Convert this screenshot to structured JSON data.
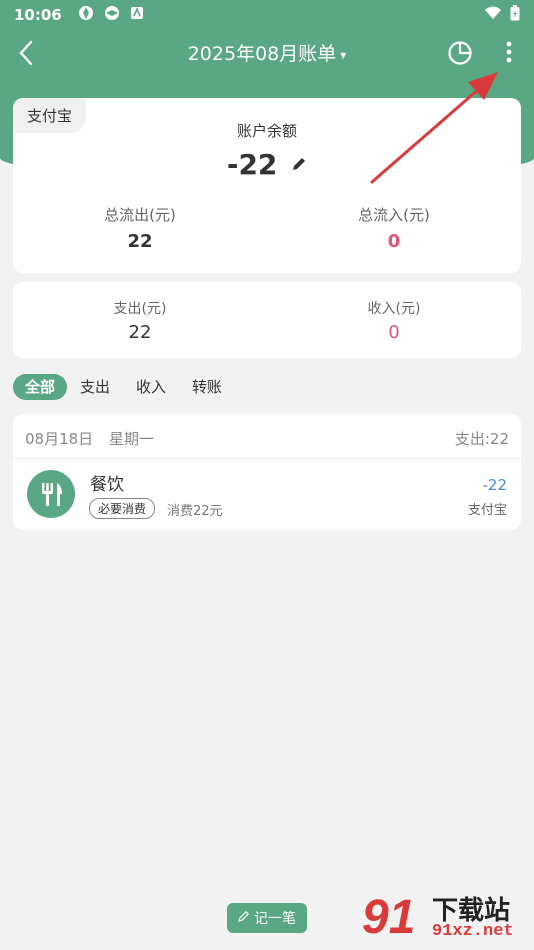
{
  "status_bar": {
    "time": "10:06",
    "icons": [
      "sync-icon",
      "sync-icon",
      "app-icon"
    ],
    "right_icons": [
      "wifi-icon",
      "battery-icon"
    ]
  },
  "nav": {
    "title": "2025年08月账单",
    "caret": "▾",
    "actions": [
      "back-icon",
      "pie-chart-icon",
      "more-vertical-icon"
    ]
  },
  "summary": {
    "source_tag": "支付宝",
    "balance_label": "账户余额",
    "balance_value": "-22",
    "outflow_label": "总流出(元)",
    "outflow_value": "22",
    "inflow_label": "总流入(元)",
    "inflow_value": "0"
  },
  "totals": {
    "expense_label": "支出(元)",
    "expense_value": "22",
    "income_label": "收入(元)",
    "income_value": "0"
  },
  "filters": [
    "全部",
    "支出",
    "收入",
    "转账"
  ],
  "day": {
    "date": "08月18日",
    "weekday": "星期一",
    "total": "支出:22"
  },
  "transaction": {
    "name": "餐饮",
    "tag": "必要消费",
    "note": "消费22元",
    "amount": "-22",
    "account": "支付宝",
    "icon": "fork-knife-icon"
  },
  "add_button": {
    "label": "记一笔"
  },
  "watermark": {
    "number": "91",
    "title": "下载站",
    "url": "91xz.net"
  },
  "colors": {
    "primary": "#5aa783",
    "income": "#e5537a",
    "expense_amount": "#4a8ad6",
    "arrow": "#d93b3b",
    "background": "#f2f2f2"
  }
}
